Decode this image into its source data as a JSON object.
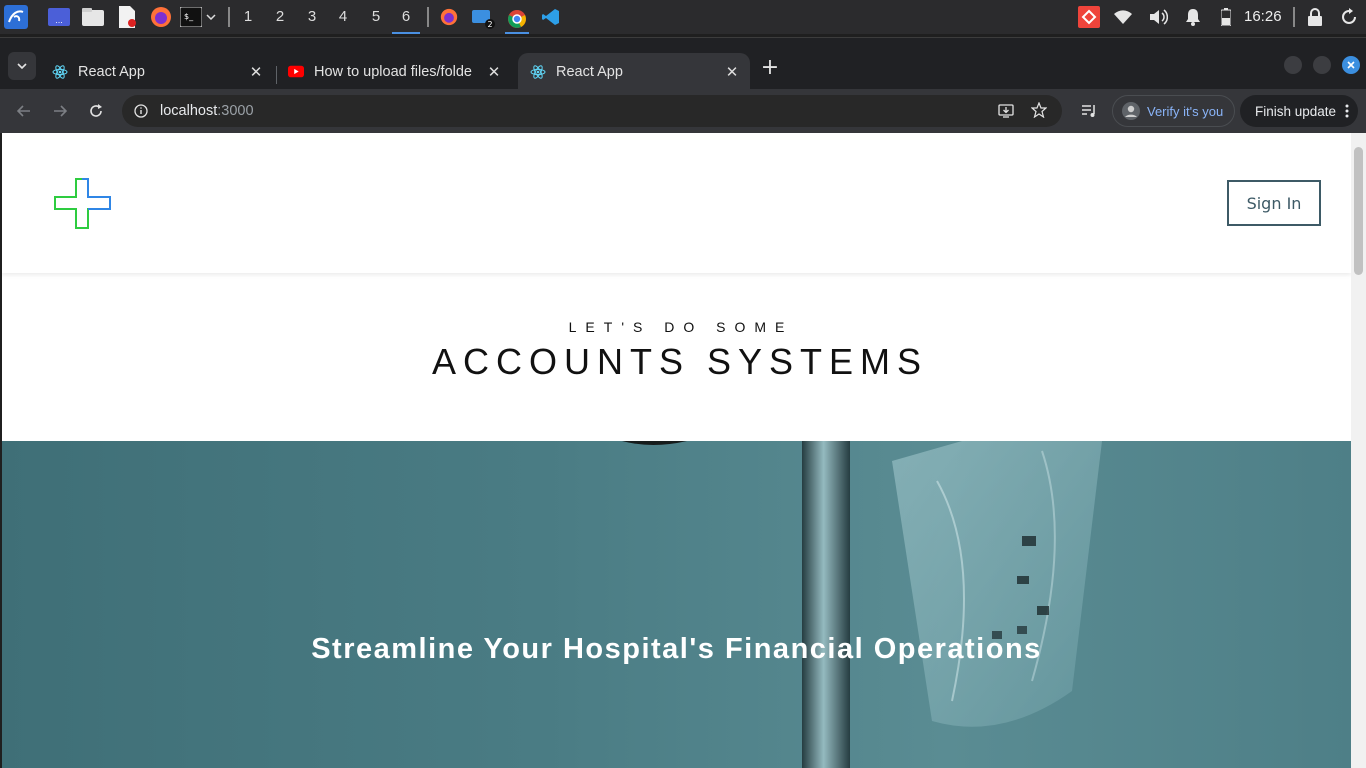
{
  "taskbar": {
    "workspaces": [
      "1",
      "2",
      "3",
      "4",
      "5",
      "6"
    ],
    "active_workspace": "6",
    "badge_count": "2",
    "clock": "16:26"
  },
  "browser": {
    "tabs": [
      {
        "title": "React App",
        "favicon": "react-icon"
      },
      {
        "title": "How to upload files/folde",
        "favicon": "youtube-icon"
      },
      {
        "title": "React App",
        "favicon": "react-icon"
      }
    ],
    "active_tab": 2,
    "address": {
      "host": "localhost",
      "port": ":3000"
    },
    "verify_label": "Verify it's you",
    "finish_update_label": "Finish update"
  },
  "page": {
    "sign_in_label": "Sign In",
    "kicker": "LET'S DO SOME",
    "headline": "ACCOUNTS SYSTEMS",
    "hero_text": "Streamline Your Hospital's Financial Operations"
  },
  "colors": {
    "accent_blue": "#4a90e2",
    "logo_blue": "#2f86e6",
    "logo_green": "#2ecc40",
    "signin_border": "#3d5a66",
    "hero_teal": "#4a7c84"
  }
}
